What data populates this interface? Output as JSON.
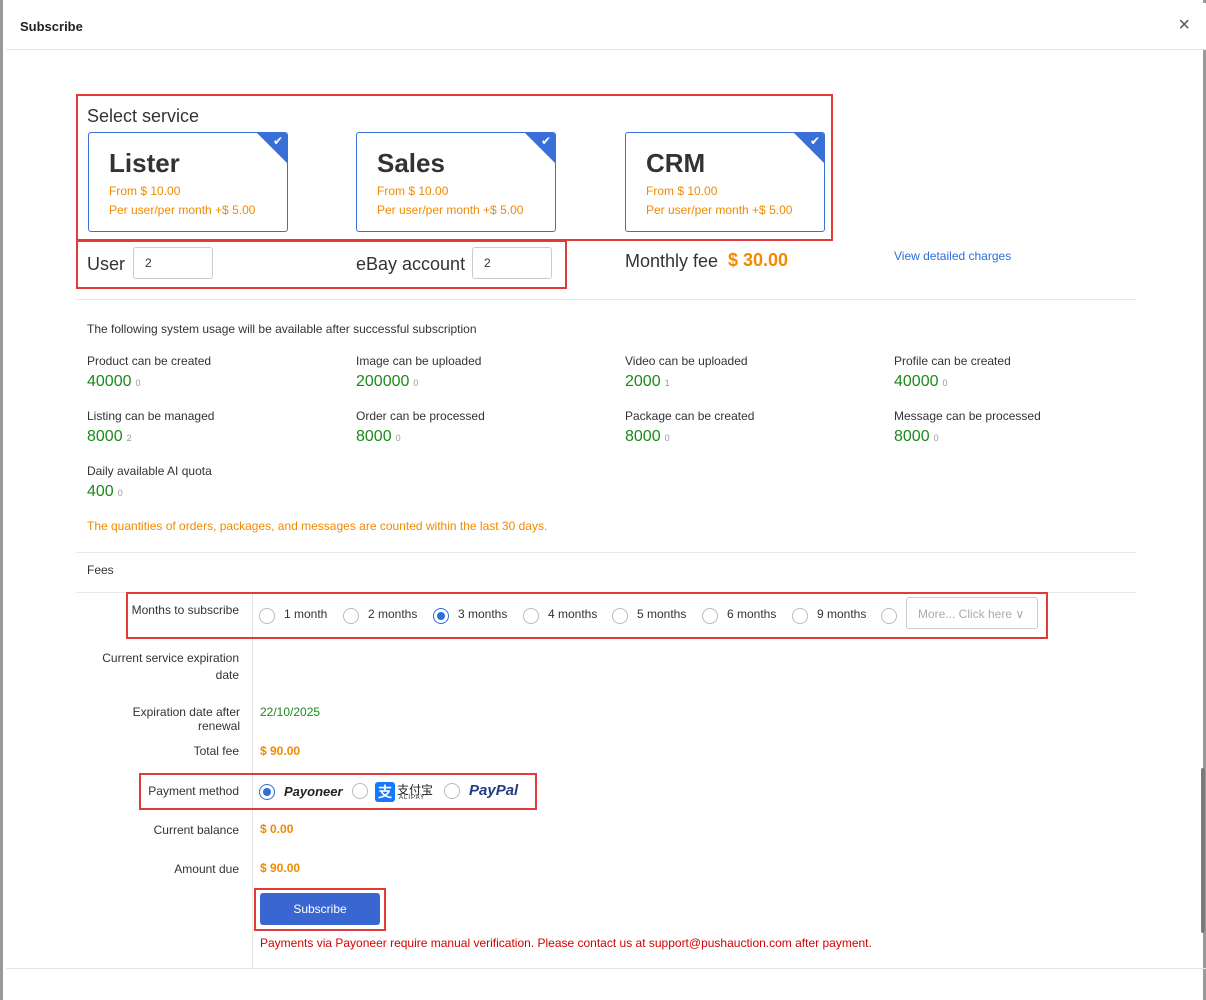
{
  "dialog": {
    "title": "Subscribe",
    "close": "×"
  },
  "select_service": {
    "title": "Select service",
    "cards": [
      {
        "name": "Lister",
        "from": "From $ 10.00",
        "per": "Per user/per month +$ 5.00",
        "checked": true
      },
      {
        "name": "Sales",
        "from": "From $ 10.00",
        "per": "Per user/per month +$ 5.00",
        "checked": true
      },
      {
        "name": "CRM",
        "from": "From $ 10.00",
        "per": "Per user/per month +$ 5.00",
        "checked": true
      }
    ],
    "check": "✔"
  },
  "counts": {
    "user_label": "User",
    "user_value": "2",
    "ebay_label": "eBay account",
    "ebay_value": "2"
  },
  "monthly_fee": {
    "label": "Monthly fee",
    "amount": "$ 30.00",
    "link": "View detailed charges"
  },
  "usage": {
    "intro": "The following system usage will be available after successful subscription",
    "items": [
      {
        "label": "Product can be created",
        "value": "40000",
        "used": "0"
      },
      {
        "label": "Image can be uploaded",
        "value": "200000",
        "used": "0"
      },
      {
        "label": "Video can be uploaded",
        "value": "2000",
        "used": "1"
      },
      {
        "label": "Profile can be created",
        "value": "40000",
        "used": "0"
      },
      {
        "label": "Listing can be managed",
        "value": "8000",
        "used": "2"
      },
      {
        "label": "Order can be processed",
        "value": "8000",
        "used": "0"
      },
      {
        "label": "Package can be created",
        "value": "8000",
        "used": "0"
      },
      {
        "label": "Message can be processed",
        "value": "8000",
        "used": "0"
      },
      {
        "label": "Daily available AI quota",
        "value": "400",
        "used": "0"
      }
    ],
    "note": "The quantities of orders, packages, and messages are counted within the last 30 days."
  },
  "fees": {
    "title": "Fees",
    "months_label": "Months to subscribe",
    "months": [
      {
        "label": "1 month",
        "selected": false
      },
      {
        "label": "2 months",
        "selected": false
      },
      {
        "label": "3 months",
        "selected": true
      },
      {
        "label": "4 months",
        "selected": false
      },
      {
        "label": "5 months",
        "selected": false
      },
      {
        "label": "6 months",
        "selected": false
      },
      {
        "label": "9 months",
        "selected": false
      }
    ],
    "more_placeholder": "More... Click here",
    "current_exp_label_1": "Current service expiration",
    "current_exp_label_2": "date",
    "exp_after_label": "Expiration date after renewal",
    "exp_after_value": "22/10/2025",
    "total_label": "Total fee",
    "total_value": "$ 90.00",
    "payment_label": "Payment method",
    "payment_methods": [
      {
        "name": "Payoneer",
        "selected": true
      },
      {
        "name": "支付宝",
        "sub": "ALIPAY",
        "selected": false
      },
      {
        "name": "PayPal",
        "selected": false
      }
    ],
    "balance_label": "Current balance",
    "balance_value": "$ 0.00",
    "due_label": "Amount due",
    "due_value": "$ 90.00",
    "subscribe_button": "Subscribe",
    "payoneer_note": "Payments via Payoneer require manual verification. Please contact us at support@pushauction.com after payment."
  },
  "colors": {
    "accent": "#3a66d1",
    "orange": "#f08a00",
    "green": "#1b8a1b",
    "highlight": "#e03a3a"
  }
}
